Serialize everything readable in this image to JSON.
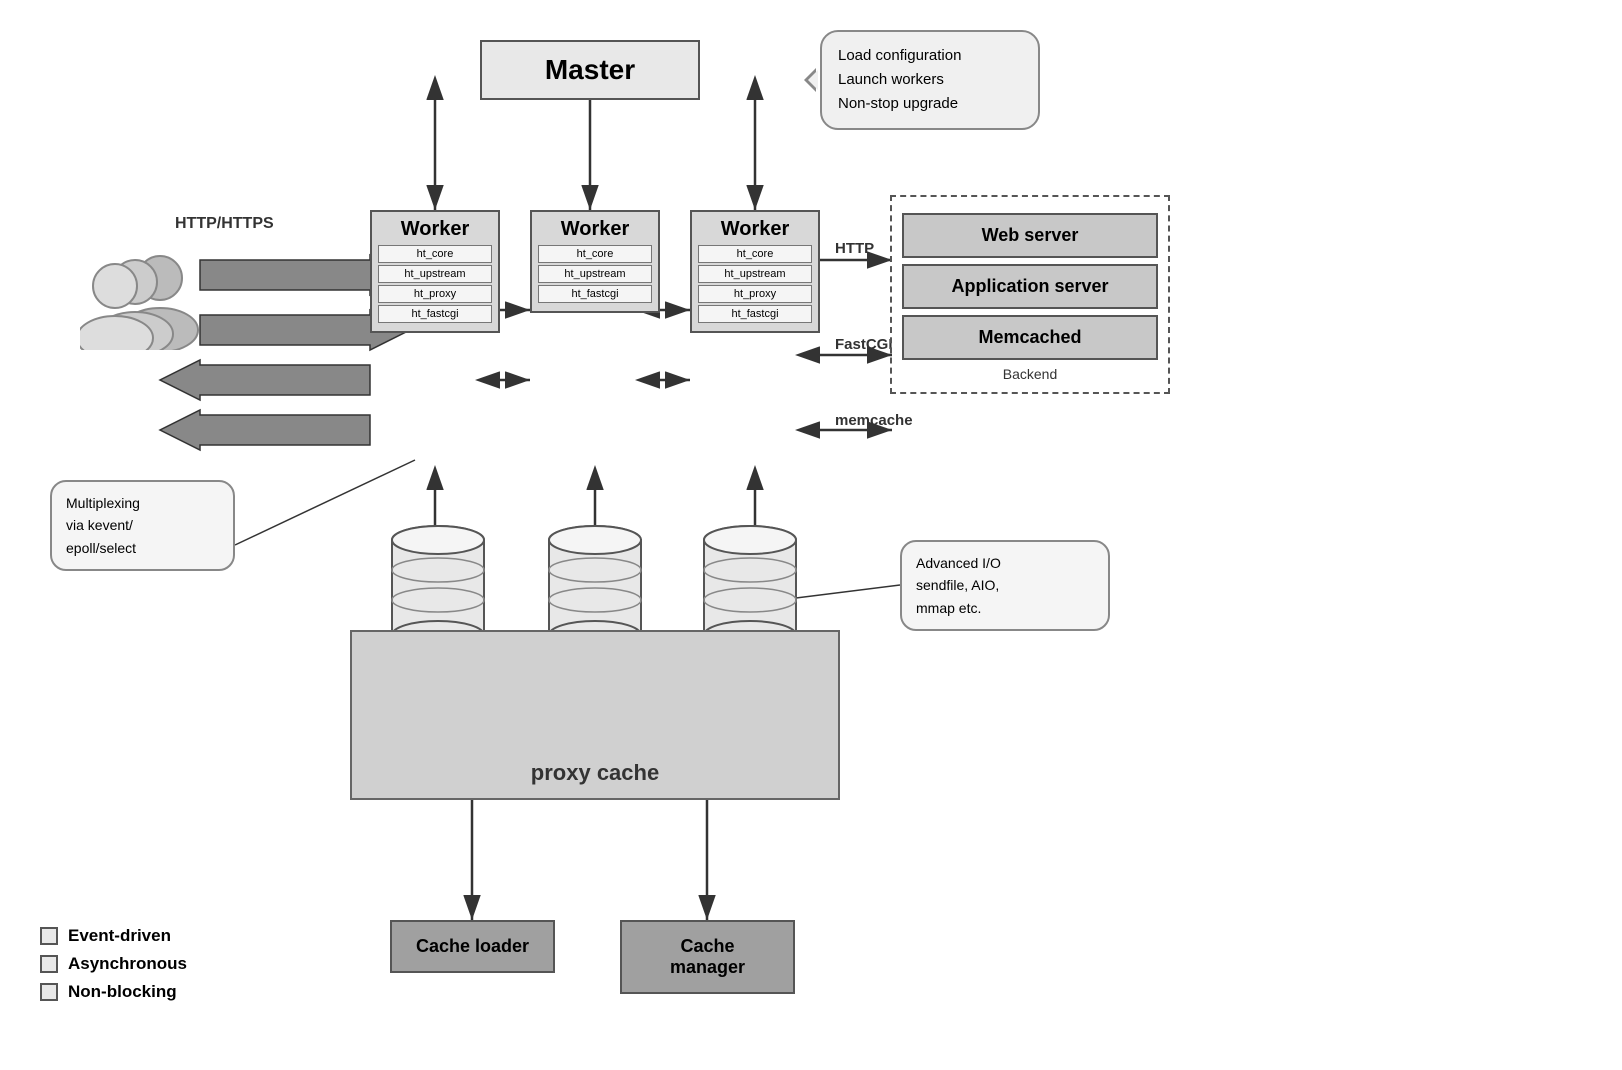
{
  "master": {
    "label": "Master",
    "callout": {
      "line1": "Load configuration",
      "line2": "Launch workers",
      "line3": "Non-stop upgrade"
    }
  },
  "workers": [
    {
      "title": "Worker",
      "modules": [
        "ht_core",
        "ht_upstream",
        "ht_proxy",
        "ht_fastcgi"
      ]
    },
    {
      "title": "Worker",
      "modules": [
        "ht_core",
        "ht_upstream",
        "ht_fastcgi"
      ]
    },
    {
      "title": "Worker",
      "modules": [
        "ht_core",
        "ht_upstream",
        "ht_proxy",
        "ht_fastcgi"
      ]
    }
  ],
  "protocols": {
    "http": "HTTP",
    "fastcgi": "FastCGI",
    "memcache": "memcache",
    "http_https": "HTTP/HTTPS"
  },
  "backend": {
    "label": "Backend",
    "servers": [
      "Web server",
      "Application server",
      "Memcached"
    ]
  },
  "proxy_cache": {
    "label": "proxy cache"
  },
  "callouts": {
    "multiplexing": "Multiplexing\nvia kevent/\nepoll/select",
    "advanced_io": "Advanced I/O\nsendfile, AIO,\nmmap etc."
  },
  "cache": {
    "loader": "Cache loader",
    "manager": "Cache manager"
  },
  "legend": {
    "items": [
      "Event-driven",
      "Asynchronous",
      "Non-blocking"
    ]
  }
}
